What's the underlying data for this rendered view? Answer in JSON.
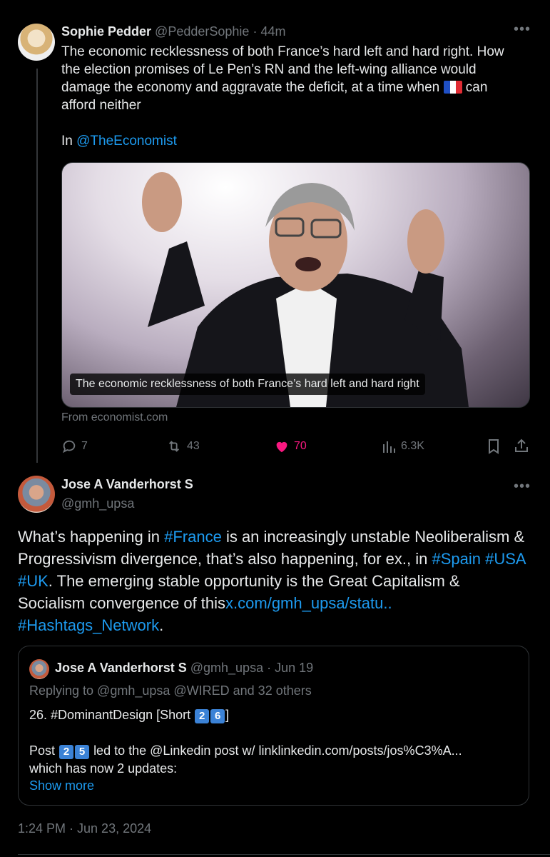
{
  "tweet1": {
    "name": "Sophie Pedder",
    "handle": "@PedderSophie",
    "sep": "·",
    "time": "44m",
    "text_line1": "The economic recklessness of both France’s hard left and hard right. How",
    "text_line2": "the election promises of Le Pen’s RN and the left-wing alliance would",
    "text_line3a": "damage the economy and aggravate the deficit, at a time when",
    "text_line3b": "can",
    "text_line4": "afford neither",
    "in_prefix": "In",
    "in_link": "@TheEconomist",
    "card_caption": "The economic recklessness of both France’s hard left and hard right",
    "card_source": "From economist.com",
    "replies": "7",
    "reposts": "43",
    "likes": "70",
    "views": "6.3K"
  },
  "tweet2": {
    "name": "Jose A Vanderhorst S",
    "handle": "@gmh_upsa",
    "t1": "What’s happening in",
    "tag_france": "#France",
    "t2": "is an increasingly unstable Neoliberalism &",
    "t3": "Progressivism divergence, that’s also happening, for ex., in",
    "tag_spain": "#Spain",
    "tag_usa": "#USA",
    "tag_uk": "#UK",
    "t4": ". The emerging stable opportunity is the Great Capitalism &",
    "t5": "Socialism convergence of this",
    "url": "x.com/gmh_upsa/statu..",
    "tag_network": "#Hashtags_Network",
    "t6": ".",
    "timestamp": "1:24 PM · Jun 23, 2024"
  },
  "quote": {
    "name": "Jose A Vanderhorst S",
    "handle": "@gmh_upsa",
    "sep": "·",
    "time": "Jun 19",
    "replying": "Replying to @gmh_upsa @WIRED and 32 others",
    "line1a": "26. #DominantDesign [Short",
    "key1": "2",
    "key2": "6",
    "line1b": "]",
    "line2a": "Post",
    "key3": "2",
    "key4": "5",
    "line2b": "led to the @Linkedin post w/ linklinkedin.com/posts/jos%C3%A...",
    "line3": "which has now 2 updates:",
    "show_more": "Show more"
  },
  "colors": {
    "accent": "#1d9bf0",
    "like": "#f91880",
    "muted": "#71767b"
  }
}
